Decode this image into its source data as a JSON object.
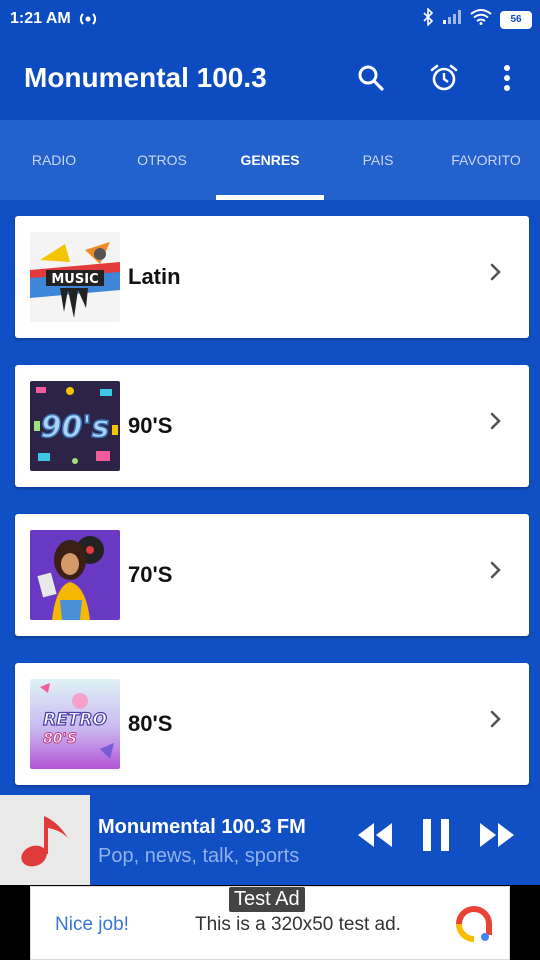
{
  "status": {
    "time": "1:21 AM",
    "battery": "56"
  },
  "app": {
    "title": "Monumental 100.3"
  },
  "tabs": [
    {
      "label": "RADIO"
    },
    {
      "label": "OTROS"
    },
    {
      "label": "GENRES"
    },
    {
      "label": "PAIS"
    },
    {
      "label": "FAVORITO"
    }
  ],
  "active_tab": "GENRES",
  "genres": [
    {
      "label": "Latin",
      "image": "music-art"
    },
    {
      "label": "90'S",
      "image": "90s-art"
    },
    {
      "label": "70'S",
      "image": "70s-disco-art"
    },
    {
      "label": "80'S",
      "image": "retro-80s-art"
    }
  ],
  "player": {
    "title": "Monumental 100.3 FM",
    "subtitle": "Pop, news, talk, sports"
  },
  "ad": {
    "label": "Test Ad",
    "nice": "Nice job!",
    "text": "This is a 320x50 test ad."
  },
  "colors": {
    "primary": "#0d4cc0",
    "tabs": "#2361cc",
    "background": "#1150c4"
  }
}
